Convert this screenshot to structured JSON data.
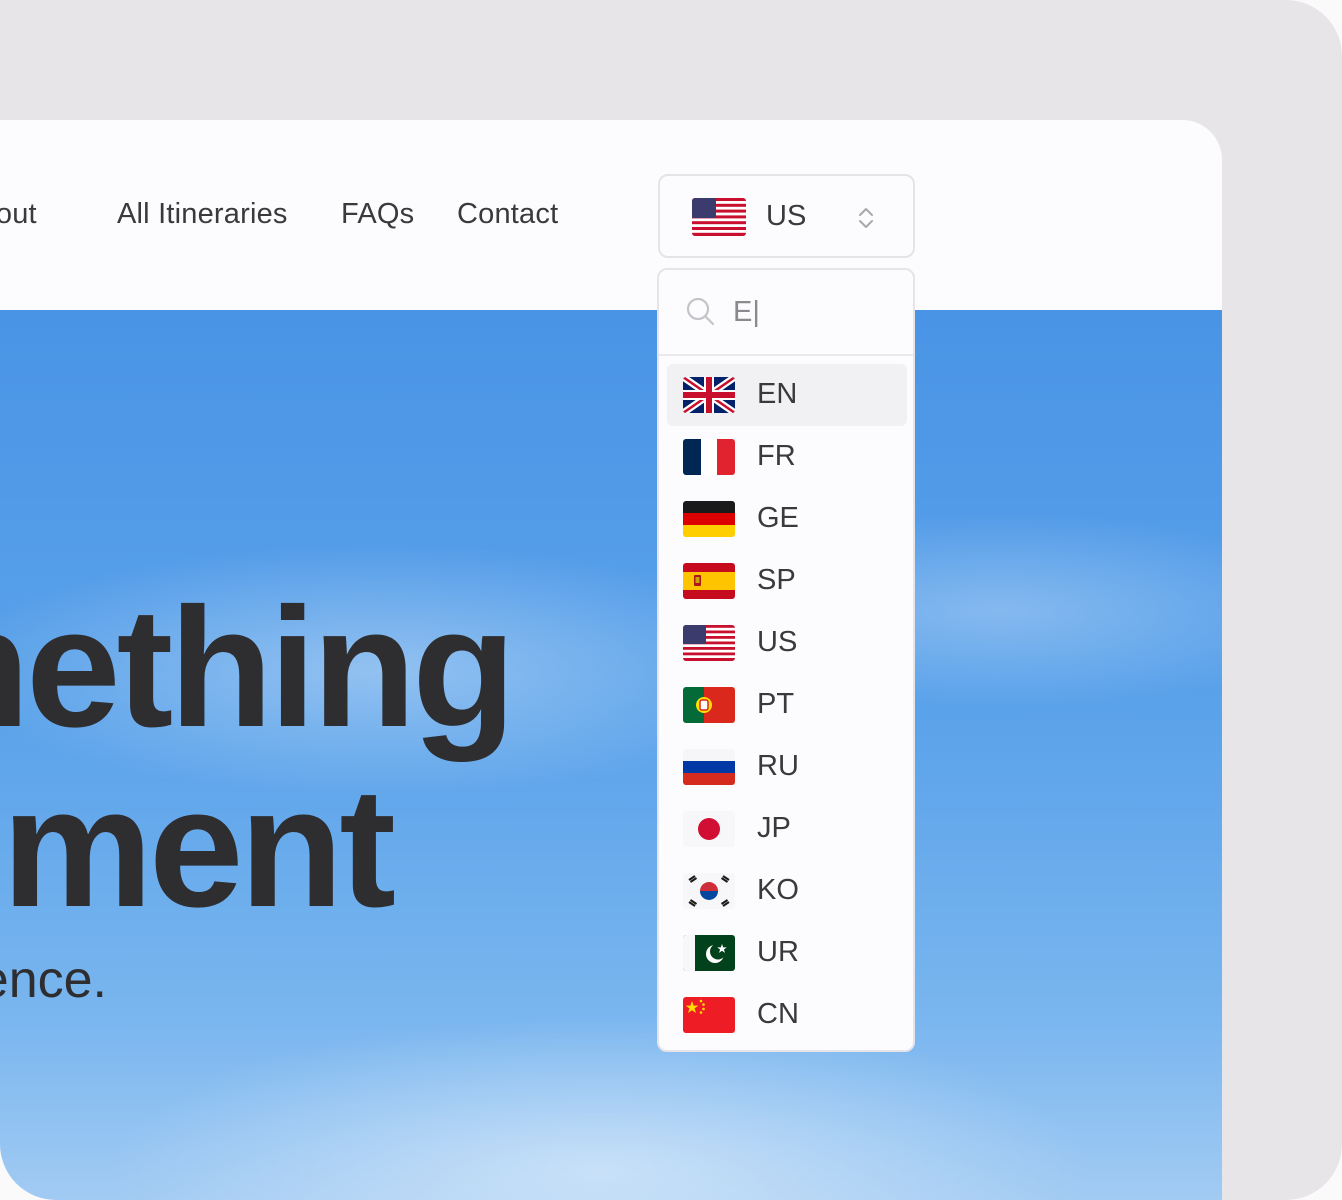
{
  "nav": {
    "links": [
      "About",
      "All Itineraries",
      "FAQs",
      "Contact"
    ]
  },
  "hero": {
    "line1": "Something",
    "line2": "Moment",
    "subtitle": "Experience."
  },
  "language_selector": {
    "selected": "US",
    "selected_flag": "us-flag-icon"
  },
  "dropdown": {
    "search_value": "E|",
    "items": [
      {
        "code": "EN",
        "flag": "uk-flag-icon",
        "highlighted": true
      },
      {
        "code": "FR",
        "flag": "france-flag-icon"
      },
      {
        "code": "GE",
        "flag": "germany-flag-icon"
      },
      {
        "code": "SP",
        "flag": "spain-flag-icon"
      },
      {
        "code": "US",
        "flag": "us-flag-icon"
      },
      {
        "code": "PT",
        "flag": "portugal-flag-icon"
      },
      {
        "code": "RU",
        "flag": "russia-flag-icon"
      },
      {
        "code": "JP",
        "flag": "japan-flag-icon"
      },
      {
        "code": "KO",
        "flag": "korea-flag-icon"
      },
      {
        "code": "UR",
        "flag": "pakistan-flag-icon"
      },
      {
        "code": "CN",
        "flag": "china-flag-icon"
      }
    ]
  },
  "colors": {
    "frame_bg": "#e7e5e8",
    "window_bg": "#fcfbfd",
    "text": "#3a3a3c",
    "hero_text": "#2e2d30",
    "sky": "#4a94e6",
    "highlight_row": "#f1f0f3"
  }
}
